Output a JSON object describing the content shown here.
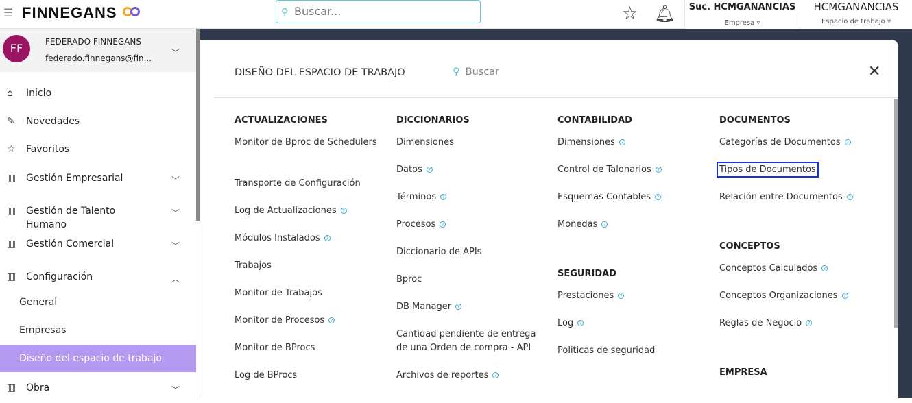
{
  "header": {
    "logo": "FINNEGANS",
    "search_placeholder": "Buscar...",
    "company": {
      "value": "Suc. HCMGANANCIAS",
      "label": "Empresa ▿"
    },
    "workspace": {
      "value": "HCMGANANCIAS",
      "label": "Espacio de trabajo ▿"
    }
  },
  "user": {
    "initials": "FF",
    "name": "FEDERADO FINNEGANS",
    "email": "federado.finnegans@fin..."
  },
  "sidebar": {
    "items": [
      {
        "label": "Inicio",
        "icon": "⌂"
      },
      {
        "label": "Novedades",
        "icon": "✎"
      },
      {
        "label": "Favoritos",
        "icon": "☆"
      },
      {
        "label": "Gestión Empresarial",
        "icon": "▥",
        "chev": "﹀"
      },
      {
        "label": "Gestión de Talento Humano",
        "icon": "▥",
        "chev": "﹀"
      },
      {
        "label": "Gestión Comercial",
        "icon": "▥",
        "chev": "﹀"
      },
      {
        "label": "Configuración",
        "icon": "▥",
        "chev": "︿"
      }
    ],
    "sub": [
      "General",
      "Empresas",
      "Diseño del espacio de trabajo"
    ],
    "last": {
      "label": "Obra",
      "icon": "▥",
      "chev": "﹀"
    }
  },
  "panel": {
    "title": "DISEÑO DEL ESPACIO DE TRABAJO",
    "search": "Buscar",
    "close": "✕",
    "columns": [
      {
        "groups": [
          {
            "title": "ACTUALIZACIONES",
            "items": [
              {
                "label": "Monitor de Bproc de Schedulers"
              },
              {
                "label": "Transporte de Configuración"
              },
              {
                "label": "Log de Actualizaciones",
                "help": true
              },
              {
                "label": "Módulos Instalados",
                "help": true
              },
              {
                "label": "Trabajos"
              },
              {
                "label": "Monitor de Trabajos"
              },
              {
                "label": "Monitor de Procesos",
                "help": true
              },
              {
                "label": "Monitor de BProcs"
              },
              {
                "label": "Log de BProcs"
              }
            ]
          }
        ]
      },
      {
        "groups": [
          {
            "title": "DICCIONARIOS",
            "items": [
              {
                "label": "Dimensiones"
              },
              {
                "label": "Datos",
                "help": true
              },
              {
                "label": "Términos",
                "help": true
              },
              {
                "label": "Procesos",
                "help": true
              },
              {
                "label": "Diccionario de APIs"
              },
              {
                "label": "Bproc"
              },
              {
                "label": "DB Manager",
                "help": true
              },
              {
                "label": "Cantidad pendiente de entrega de una Orden de compra - API"
              },
              {
                "label": "Archivos de reportes",
                "help": true
              }
            ]
          }
        ]
      },
      {
        "groups": [
          {
            "title": "CONTABILIDAD",
            "items": [
              {
                "label": "Dimensiones",
                "help": true
              },
              {
                "label": "Control de Talonarios",
                "help": true
              },
              {
                "label": "Esquemas Contables",
                "help": true
              },
              {
                "label": "Monedas",
                "help": true
              }
            ]
          },
          {
            "title": "SEGURIDAD",
            "items": [
              {
                "label": "Prestaciones",
                "help": true
              },
              {
                "label": "Log",
                "help": true
              },
              {
                "label": "Politicas de seguridad"
              }
            ]
          }
        ]
      },
      {
        "groups": [
          {
            "title": "DOCUMENTOS",
            "items": [
              {
                "label": "Categorías de Documentos",
                "help": true
              },
              {
                "label": "Tipos de Documentos",
                "selected": true
              },
              {
                "label": "Relación entre Documentos",
                "help": true
              }
            ]
          },
          {
            "title": "CONCEPTOS",
            "items": [
              {
                "label": "Conceptos Calculados",
                "help": true
              },
              {
                "label": "Conceptos Organizaciones",
                "help": true
              },
              {
                "label": "Reglas de Negocio",
                "help": true
              }
            ]
          },
          {
            "title": "EMPRESA",
            "items": []
          }
        ]
      }
    ]
  }
}
